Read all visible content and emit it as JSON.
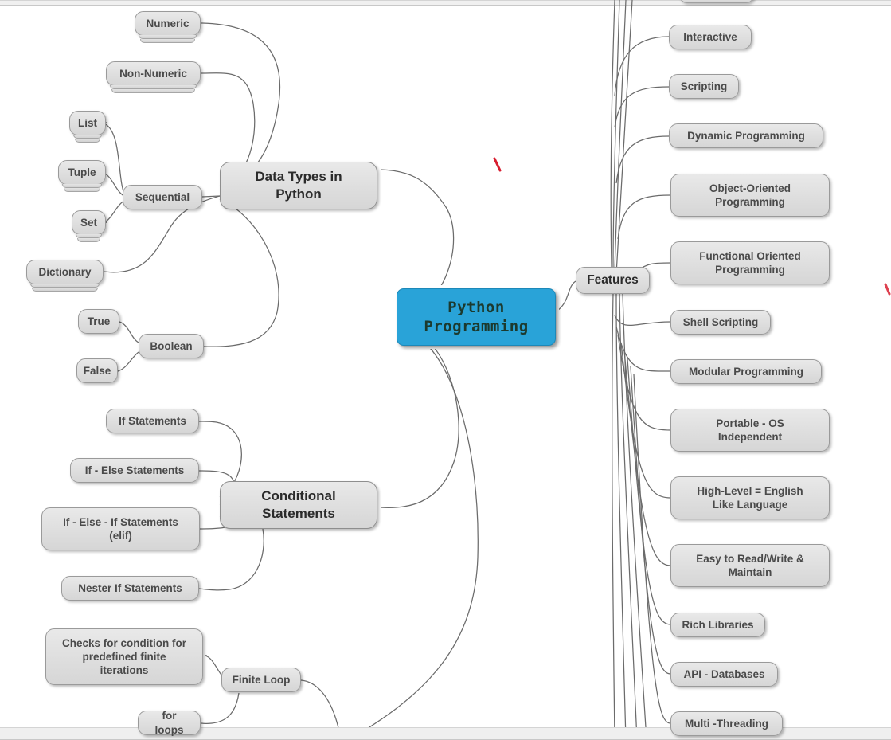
{
  "app": {
    "type": "mind-map",
    "root_color": "#29a3d8",
    "node_color": "#dedede",
    "edge_color": "#6b6b6b",
    "annotation_color": "#d81e30"
  },
  "root": {
    "label": "Python\nProgramming"
  },
  "branches": {
    "data_types": {
      "label": "Data Types in\nPython",
      "children": [
        {
          "label": "Numeric",
          "collapsed": true
        },
        {
          "label": "Non-Numeric",
          "collapsed": true
        },
        {
          "label": "Sequential",
          "collapsed": false
        },
        {
          "label": "Dictionary",
          "collapsed": true
        },
        {
          "label": "Boolean",
          "collapsed": false
        }
      ],
      "sequential_children": [
        {
          "label": "List",
          "collapsed": true
        },
        {
          "label": "Tuple",
          "collapsed": true
        },
        {
          "label": "Set",
          "collapsed": true
        }
      ],
      "boolean_children": [
        {
          "label": "True",
          "collapsed": false
        },
        {
          "label": "False",
          "collapsed": false
        }
      ]
    },
    "conditional": {
      "label": "Conditional\nStatements",
      "children": [
        {
          "label": "If Statements"
        },
        {
          "label": "If - Else Statements"
        },
        {
          "label": "If - Else - If Statements\n(elif)"
        },
        {
          "label": "Nester If Statements"
        }
      ]
    },
    "loops": {
      "finite_loop": {
        "label": "Finite Loop"
      },
      "finite_children": [
        {
          "label": "Checks for condition for\npredefined finite\niterations"
        },
        {
          "label": "for loops"
        }
      ]
    },
    "features": {
      "label": "Features",
      "children": [
        {
          "label": "Interactive"
        },
        {
          "label": "Scripting"
        },
        {
          "label": "Dynamic Programming"
        },
        {
          "label": "Object-Oriented\nProgramming"
        },
        {
          "label": "Functional Oriented\nProgramming"
        },
        {
          "label": "Shell Scripting"
        },
        {
          "label": "Modular Programming"
        },
        {
          "label": "Portable - OS\nIndependent"
        },
        {
          "label": "High-Level = English\nLike Language"
        },
        {
          "label": "Easy to Read/Write &\nMaintain"
        },
        {
          "label": "Rich Libraries"
        },
        {
          "label": "API - Databases"
        },
        {
          "label": "Multi -Threading"
        }
      ]
    }
  }
}
